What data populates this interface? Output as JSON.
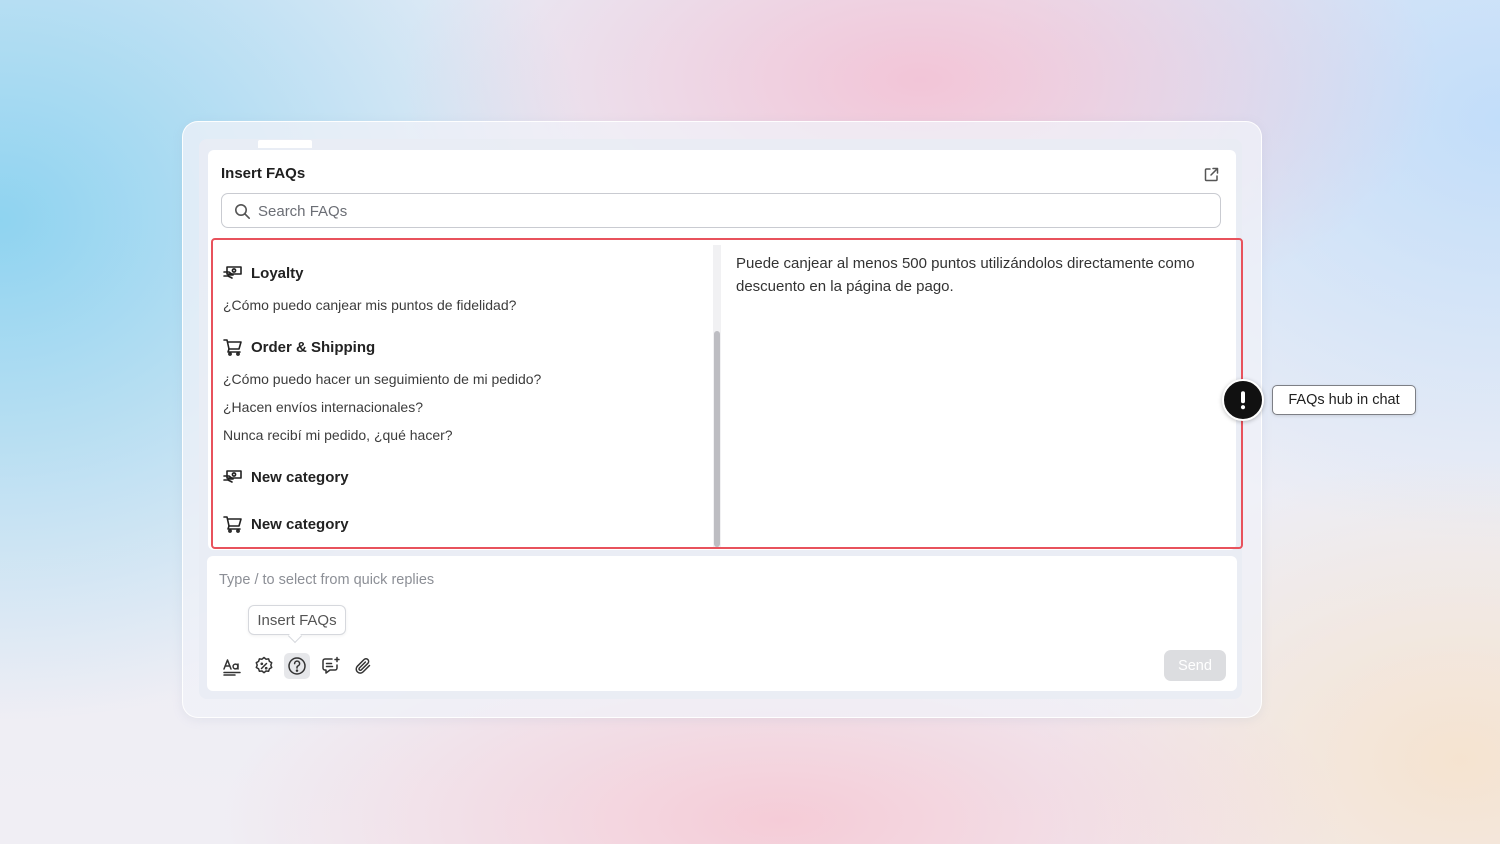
{
  "faq_panel": {
    "title": "Insert FAQs",
    "search_placeholder": "Search FAQs",
    "categories": [
      {
        "name": "Loyalty",
        "icon": "cash-hand-icon",
        "questions": [
          "¿Cómo puedo canjear mis puntos de fidelidad?"
        ]
      },
      {
        "name": "Order & Shipping",
        "icon": "cart-icon",
        "questions": [
          "¿Cómo puedo hacer un seguimiento de mi pedido?",
          "¿Hacen envíos internacionales?",
          "Nunca recibí mi pedido, ¿qué hacer?"
        ]
      },
      {
        "name": "New category",
        "icon": "cash-hand-icon",
        "questions": []
      },
      {
        "name": "New category",
        "icon": "cart-icon",
        "questions": []
      }
    ],
    "answer": "Puede canjear al menos 500 puntos utilizándolos directamente como descuento en la página de pago."
  },
  "composer": {
    "placeholder": "Type / to select from quick replies",
    "tooltip": "Insert FAQs",
    "tools": [
      "text-format-icon",
      "discount-badge-icon",
      "help-circle-icon",
      "chat-bubble-sparkle-icon",
      "paperclip-icon"
    ],
    "send_label": "Send"
  },
  "annotation": {
    "label": "FAQs hub in chat",
    "highlight_color": "#e8525c"
  }
}
